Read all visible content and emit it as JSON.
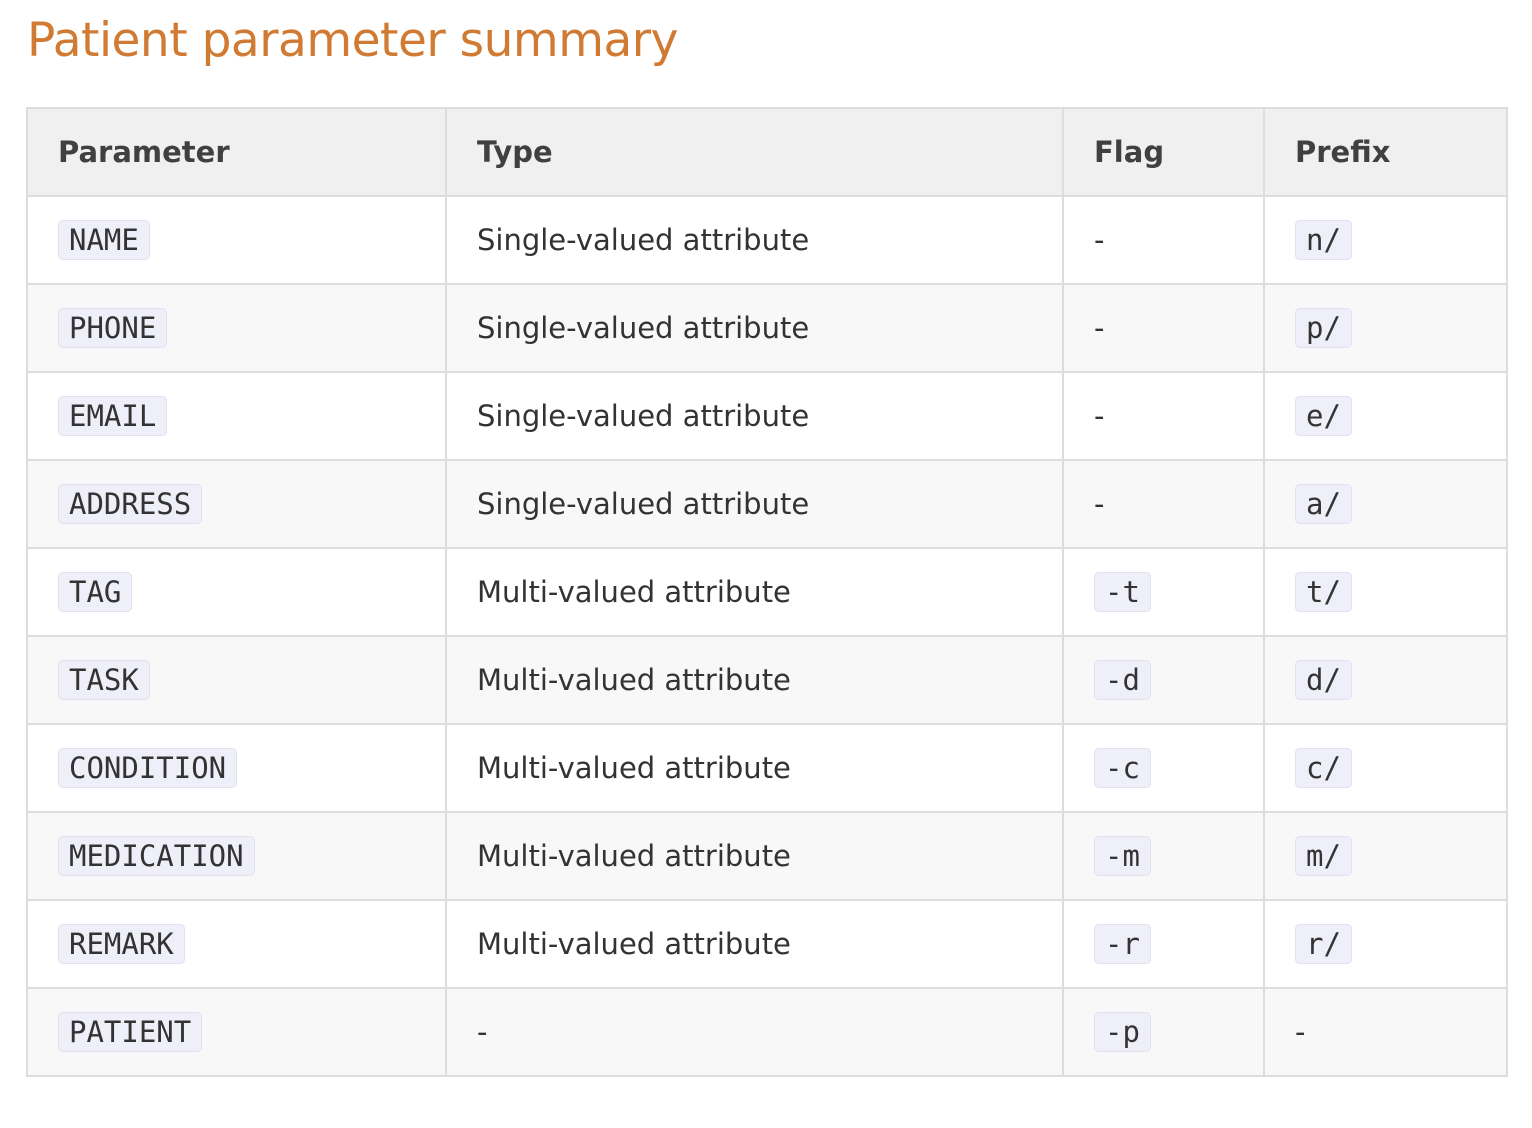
{
  "title": "Patient parameter summary",
  "table": {
    "headers": {
      "parameter": "Parameter",
      "type": "Type",
      "flag": "Flag",
      "prefix": "Prefix"
    },
    "rows": [
      {
        "parameter": "NAME",
        "type": "Single-valued attribute",
        "flag": "-",
        "prefix": "n/"
      },
      {
        "parameter": "PHONE",
        "type": "Single-valued attribute",
        "flag": "-",
        "prefix": "p/"
      },
      {
        "parameter": "EMAIL",
        "type": "Single-valued attribute",
        "flag": "-",
        "prefix": "e/"
      },
      {
        "parameter": "ADDRESS",
        "type": "Single-valued attribute",
        "flag": "-",
        "prefix": "a/"
      },
      {
        "parameter": "TAG",
        "type": "Multi-valued attribute",
        "flag": "-t",
        "prefix": "t/"
      },
      {
        "parameter": "TASK",
        "type": "Multi-valued attribute",
        "flag": "-d",
        "prefix": "d/"
      },
      {
        "parameter": "CONDITION",
        "type": "Multi-valued attribute",
        "flag": "-c",
        "prefix": "c/"
      },
      {
        "parameter": "MEDICATION",
        "type": "Multi-valued attribute",
        "flag": "-m",
        "prefix": "m/"
      },
      {
        "parameter": "REMARK",
        "type": "Multi-valued attribute",
        "flag": "-r",
        "prefix": "r/"
      },
      {
        "parameter": "PATIENT",
        "type": "-",
        "flag": "-p",
        "prefix": "-"
      }
    ]
  },
  "colors": {
    "title": "#d07a33",
    "header_bg": "#f0f0f0",
    "code_bg": "#efeff9",
    "border": "#dddddd"
  }
}
